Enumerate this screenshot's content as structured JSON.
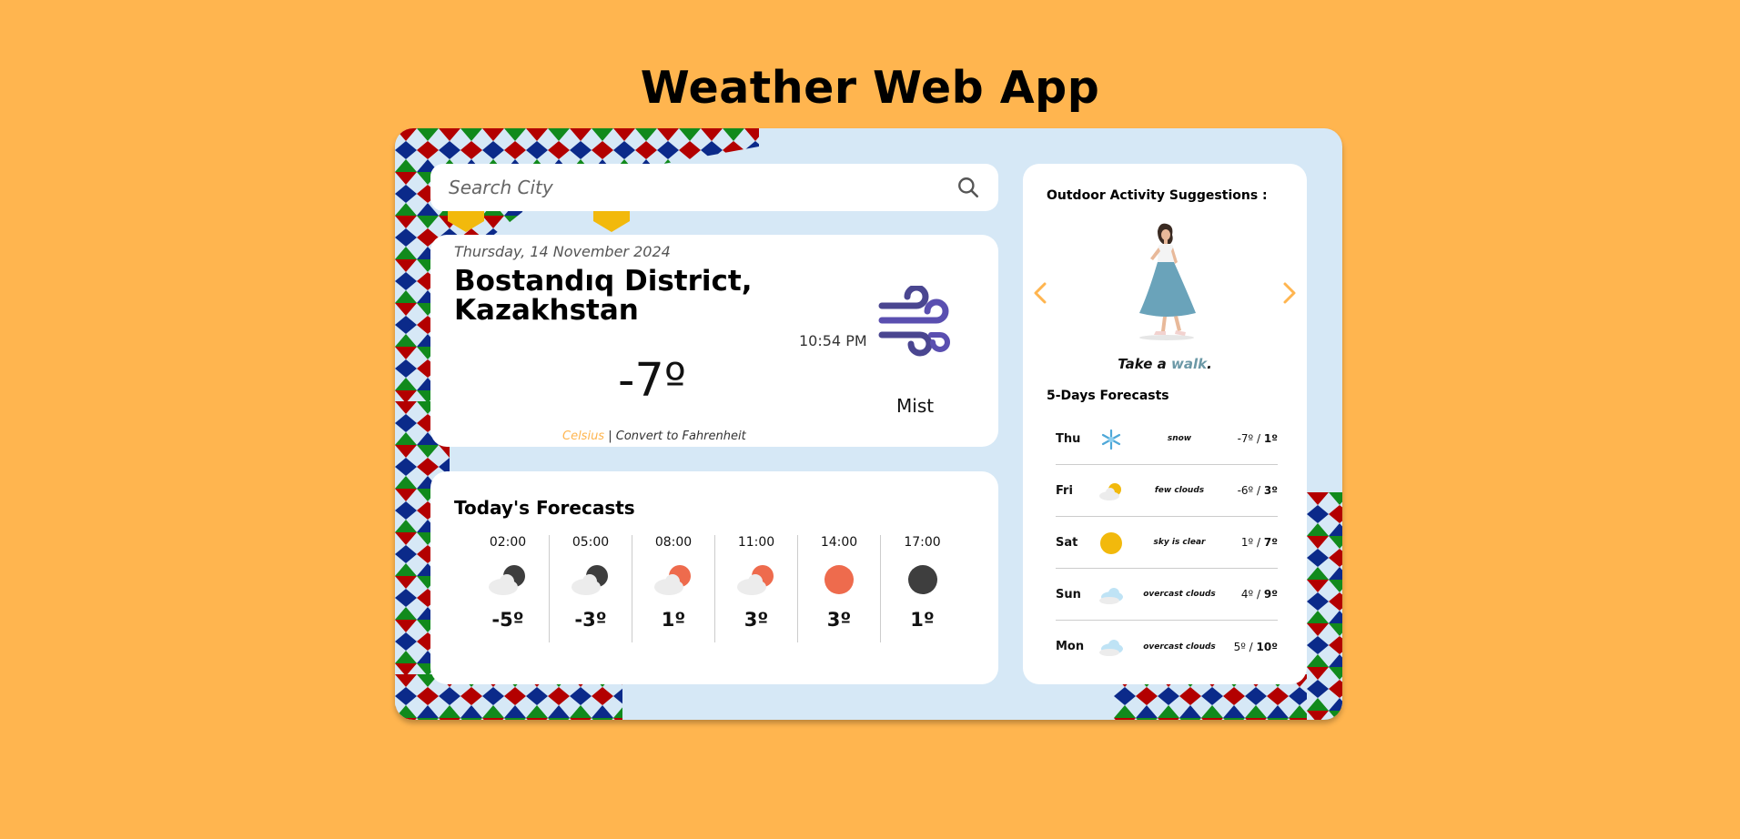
{
  "page": {
    "title": "Weather Web App"
  },
  "search": {
    "placeholder": "Search City"
  },
  "current": {
    "date": "Thursday, 14 November 2024",
    "location": "Bostandıq District, Kazakhstan",
    "time": "10:54 PM",
    "temperature": "-7º",
    "condition": "Mist",
    "icon": "wind-icon",
    "unit_celsius": "Celsius",
    "unit_separator": " | ",
    "unit_convert": "Convert to Fahrenheit"
  },
  "today": {
    "title": "Today's Forecasts",
    "hours": [
      {
        "time": "02:00",
        "temp": "-5º",
        "icon": "moon-cloud-icon"
      },
      {
        "time": "05:00",
        "temp": "-3º",
        "icon": "moon-cloud-icon"
      },
      {
        "time": "08:00",
        "temp": "1º",
        "icon": "sun-cloud-icon"
      },
      {
        "time": "11:00",
        "temp": "3º",
        "icon": "sun-cloud-icon"
      },
      {
        "time": "14:00",
        "temp": "3º",
        "icon": "sun-icon"
      },
      {
        "time": "17:00",
        "temp": "1º",
        "icon": "moon-icon"
      }
    ]
  },
  "suggestions": {
    "title": "Outdoor Activity Suggestions :",
    "activity_prefix": "Take a ",
    "activity_highlight": "walk",
    "activity_suffix": ".",
    "image": "walking-woman-illustration"
  },
  "forecast": {
    "title": "5-Days Forecasts",
    "days": [
      {
        "day": "Thu",
        "desc": "snow",
        "min": "-7º",
        "max": "1º",
        "icon": "snowflake-icon"
      },
      {
        "day": "Fri",
        "desc": "few clouds",
        "min": "-6º",
        "max": "3º",
        "icon": "few-clouds-icon"
      },
      {
        "day": "Sat",
        "desc": "sky is clear",
        "min": "1º",
        "max": "7º",
        "icon": "sun-icon"
      },
      {
        "day": "Sun",
        "desc": "overcast clouds",
        "min": "4º",
        "max": "9º",
        "icon": "overcast-clouds-icon"
      },
      {
        "day": "Mon",
        "desc": "overcast clouds",
        "min": "5º",
        "max": "10º",
        "icon": "overcast-clouds-icon"
      }
    ],
    "separator": " / "
  },
  "colors": {
    "background": "#FFB54F",
    "card_bg": "#D6E8F6",
    "accent": "#FFB54F",
    "sun": "#EE6B4D",
    "moon": "#3E3E3E",
    "pattern_red": "#B30000",
    "pattern_blue": "#0B2A8A",
    "pattern_green": "#118A1C",
    "pattern_yellow": "#F2B90C"
  }
}
